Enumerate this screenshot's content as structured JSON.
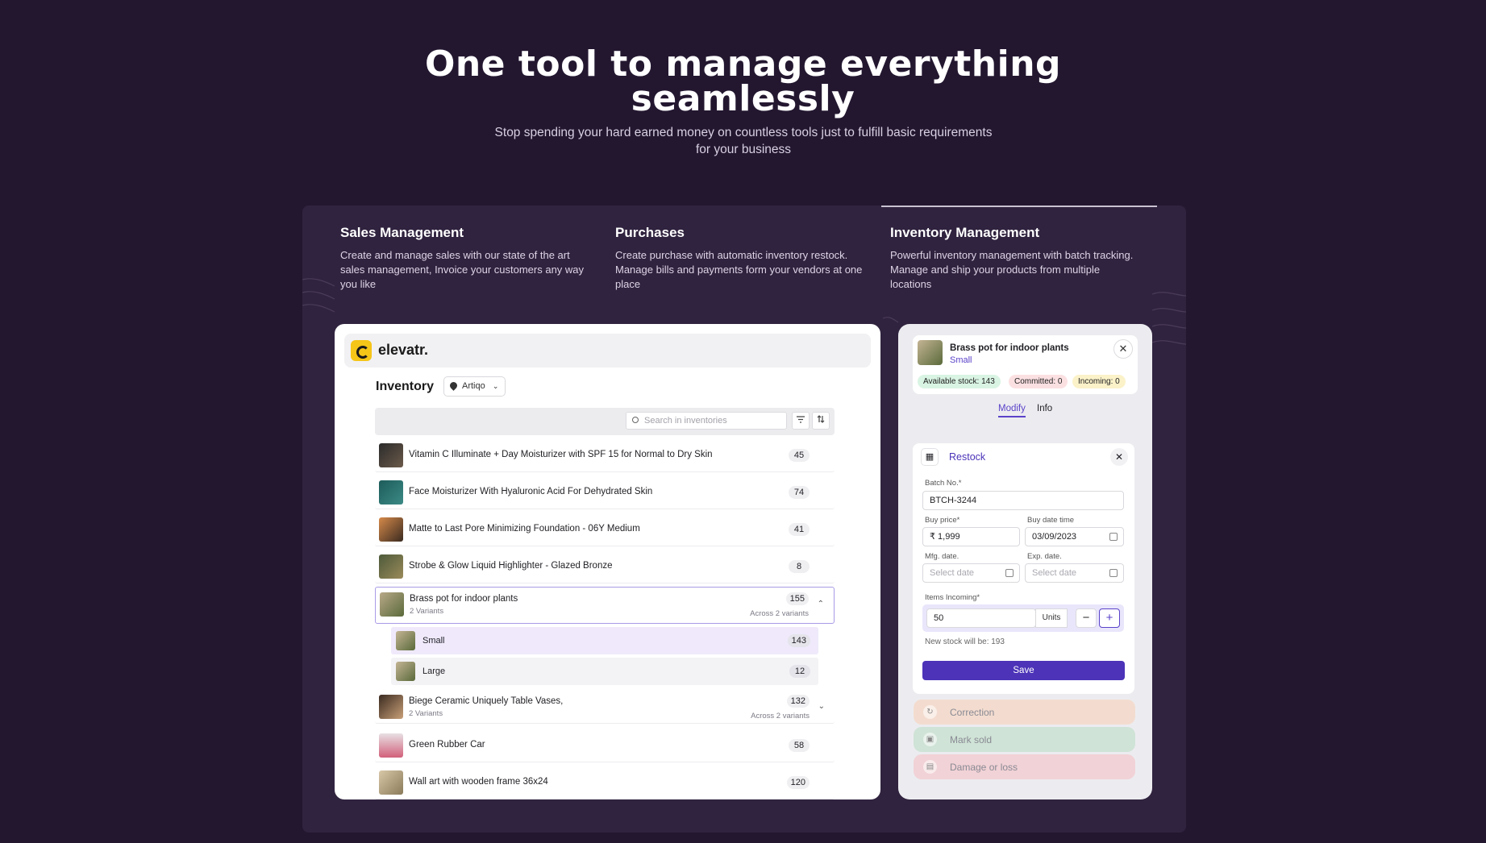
{
  "hero": {
    "title_line1": "One tool to manage everything",
    "title_line2": "seamlessly",
    "subtitle": "Stop spending your hard earned money on countless tools just to fulfill basic requirements for your business"
  },
  "features": [
    {
      "title": "Sales Management",
      "desc": "Create and manage sales with our state of the art sales management, Invoice your customers any way you like"
    },
    {
      "title": "Purchases",
      "desc": "Create purchase with automatic inventory restock. Manage bills and payments form your vendors at one place"
    },
    {
      "title": "Inventory Management",
      "desc": "Powerful inventory management with batch tracking. Manage and ship your products from multiple locations"
    }
  ],
  "app": {
    "logo": "elevatr.",
    "page_title": "Inventory",
    "location": "Artiqo",
    "search_placeholder": "Search in inventories",
    "filter_icon": "filter-icon",
    "sort_icon": "sort-icon"
  },
  "rows": [
    {
      "name": "Vitamin C Illuminate + Day Moisturizer with SPF 15 for Normal to Dry Skin",
      "qty": "45"
    },
    {
      "name": "Face Moisturizer With Hyaluronic Acid For Dehydrated Skin",
      "qty": "74"
    },
    {
      "name": "Matte to Last Pore Minimizing Foundation - 06Y Medium",
      "qty": "41"
    },
    {
      "name": "Strobe & Glow Liquid Highlighter - Glazed Bronze",
      "qty": "8"
    },
    {
      "name": "Brass pot for indoor plants",
      "sub": "2 Variants",
      "qty": "155",
      "across": "Across 2 variants"
    },
    {
      "name": "Biege Ceramic Uniquely Table Vases,",
      "sub": "2 Variants",
      "qty": "132",
      "across": "Across 2 variants"
    },
    {
      "name": "Green Rubber Car",
      "qty": "58"
    },
    {
      "name": "Wall art with wooden frame 36x24",
      "qty": "120"
    }
  ],
  "variants": [
    {
      "name": "Small",
      "qty": "143"
    },
    {
      "name": "Large",
      "qty": "12"
    }
  ],
  "detail": {
    "product_name": "Brass pot for indoor plants",
    "variant": "Small",
    "available": "Available stock: 143",
    "committed": "Committed: 0",
    "incoming": "Incoming: 0",
    "tab_modify": "Modify",
    "tab_info": "Info",
    "restock_title": "Restock",
    "batch_label": "Batch No.*",
    "batch_value": "BTCH-3244",
    "buy_price_label": "Buy price*",
    "buy_price_value": "₹ 1,999",
    "buy_date_label": "Buy date time",
    "buy_date_value": "03/09/2023",
    "mfg_label": "Mfg. date.",
    "mfg_placeholder": "Select date",
    "exp_label": "Exp. date.",
    "exp_placeholder": "Select date",
    "items_label": "Items Incoming*",
    "items_value": "50",
    "units": "Units",
    "minus": "−",
    "plus": "+",
    "new_stock": "New stock will be: 193",
    "save": "Save",
    "correction": "Correction",
    "mark_sold": "Mark sold",
    "damage": "Damage or loss"
  },
  "colors": {
    "background": "#231730",
    "section": "#30233f",
    "accent": "#4c33b8",
    "available_pill": "#d9f4e3",
    "committed_pill": "#fbe0e2",
    "incoming_pill": "#fbf2c9",
    "correction": "#f3dccf",
    "mark_sold": "#cfe3d6",
    "damage": "#f1d2d6"
  }
}
